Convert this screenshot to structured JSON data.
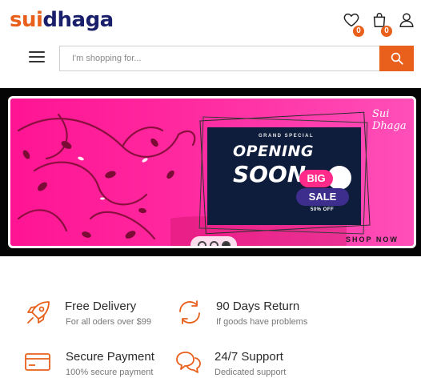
{
  "header": {
    "logo_part1": "sui",
    "logo_part2": "dhaga",
    "wishlist_count": "0",
    "cart_count": "0"
  },
  "search": {
    "placeholder": "I'm shopping for..."
  },
  "banner": {
    "tag": "GRAND SPECIAL",
    "headline1": "OPENING",
    "headline2": "SOON",
    "big": "BIG",
    "sale": "SALE",
    "discount": "50% OFF",
    "brand_mark": "Sui Dhaga",
    "cta": "SHOP NOW",
    "slides_total": 3,
    "active_slide": 3
  },
  "features": [
    {
      "title": "Free Delivery",
      "subtitle": "For all oders over $99",
      "icon": "rocket-icon"
    },
    {
      "title": "90 Days Return",
      "subtitle": "If goods have problems",
      "icon": "return-arrows-icon"
    },
    {
      "title": "Secure Payment",
      "subtitle": "100% secure payment",
      "icon": "credit-card-icon"
    },
    {
      "title": "24/7 Support",
      "subtitle": "Dedicated support",
      "icon": "chat-bubbles-icon"
    }
  ],
  "colors": {
    "accent": "#e8601c",
    "brand_dark": "#1a1f6b",
    "banner_pink": "#ff1493"
  }
}
